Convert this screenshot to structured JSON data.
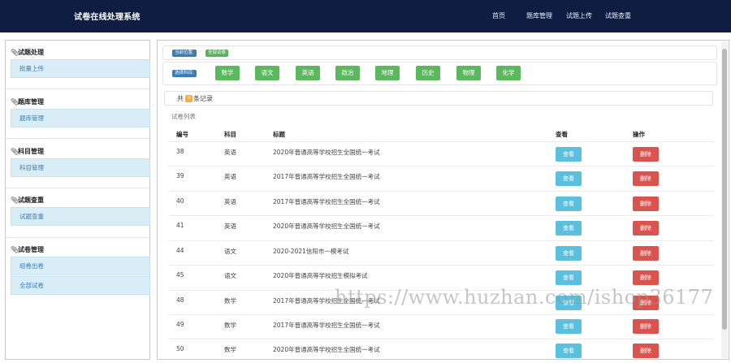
{
  "app": {
    "title": "试卷在线处理系统"
  },
  "topnav": [
    {
      "label": "首页"
    },
    {
      "label": "题库管理"
    },
    {
      "label": "试题上传"
    },
    {
      "label": "试题查重"
    }
  ],
  "sidebar": [
    {
      "title": "试题处理",
      "items": [
        {
          "label": "批量上传"
        }
      ]
    },
    {
      "title": "题库管理",
      "items": [
        {
          "label": "题库管理"
        }
      ]
    },
    {
      "title": "科目管理",
      "items": [
        {
          "label": "科目管理"
        }
      ]
    },
    {
      "title": "试题查重",
      "items": [
        {
          "label": "试题查重"
        }
      ]
    },
    {
      "title": "试卷管理",
      "items": [
        {
          "label": "组卷出卷"
        },
        {
          "label": "全部试卷"
        }
      ]
    }
  ],
  "breadcrumb": {
    "label": "当前位置:",
    "current": "全部试卷"
  },
  "subject_filter": {
    "label": "选择科目:",
    "subjects": [
      "数学",
      "语文",
      "英语",
      "政治",
      "地理",
      "历史",
      "物理",
      "化学"
    ]
  },
  "record_count": {
    "prefix": "共",
    "count": "9",
    "suffix": "条记录"
  },
  "list": {
    "title": "试卷列表",
    "headers": {
      "id": "编号",
      "subject": "科目",
      "title": "标题",
      "view": "查看",
      "action": "操作"
    },
    "view_label": "查看",
    "delete_label": "删除",
    "rows": [
      {
        "id": "38",
        "subject": "英语",
        "title": "2020年普通高等学校招生全国统一考试"
      },
      {
        "id": "39",
        "subject": "英语",
        "title": "2017年普通高等学校招生全国统一考试"
      },
      {
        "id": "40",
        "subject": "英语",
        "title": "2017年普通高等学校招生全国统一考试"
      },
      {
        "id": "41",
        "subject": "英语",
        "title": "2020年普通高等学校招生全国统一考试"
      },
      {
        "id": "44",
        "subject": "语文",
        "title": "2020-2021信阳市一模考试"
      },
      {
        "id": "45",
        "subject": "语文",
        "title": "2020年普通高等学校招生模拟考试"
      },
      {
        "id": "48",
        "subject": "数学",
        "title": "2017年普通高等学校招生全国统一考试"
      },
      {
        "id": "49",
        "subject": "数学",
        "title": "2017年普通高等学校招生全国统一考试"
      },
      {
        "id": "50",
        "subject": "数学",
        "title": "2020年普通高等学校招生全国统一考试"
      }
    ]
  },
  "watermark": "https://www.huzhan.com/ishop36177",
  "colors": {
    "topbar": "#0f1d42",
    "subject_button": "#5cb85c",
    "view_button": "#5bc0de",
    "delete_button": "#d9534f",
    "sidebar_item": "#d9edf7"
  }
}
